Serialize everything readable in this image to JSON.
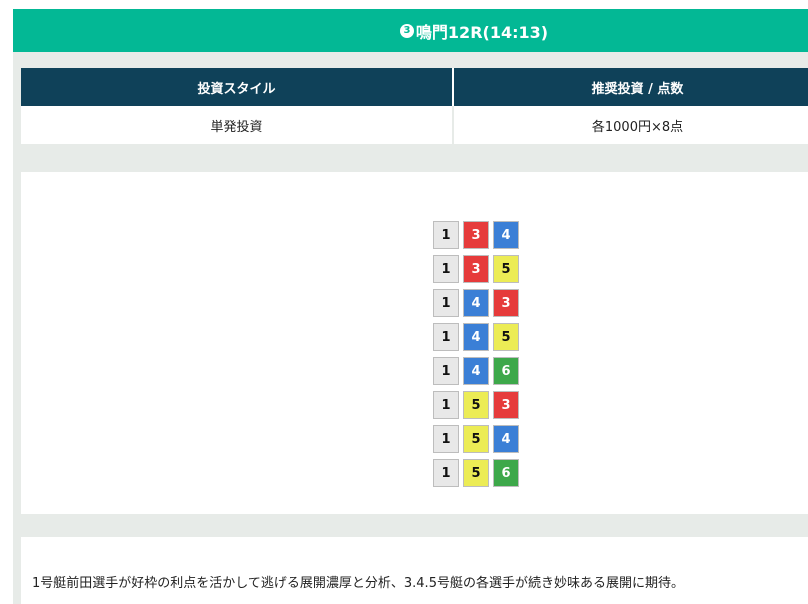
{
  "header": {
    "race_number": "3",
    "title": "鳴門12R(14:13)"
  },
  "bet_table": {
    "headers": [
      "投資スタイル",
      "推奨投資 / 点数"
    ],
    "row": [
      "単発投資",
      "各1000円×8点"
    ]
  },
  "boat_colors": {
    "1": {
      "bg": "#e8e8e8",
      "fg": "#111111"
    },
    "3": {
      "bg": "#e63b3b",
      "fg": "#ffffff"
    },
    "4": {
      "bg": "#3b7fd6",
      "fg": "#ffffff"
    },
    "5": {
      "bg": "#ecec55",
      "fg": "#111111"
    },
    "6": {
      "bg": "#3da84a",
      "fg": "#ffffff"
    }
  },
  "combinations": [
    [
      "1",
      "3",
      "4"
    ],
    [
      "1",
      "3",
      "5"
    ],
    [
      "1",
      "4",
      "3"
    ],
    [
      "1",
      "4",
      "5"
    ],
    [
      "1",
      "4",
      "6"
    ],
    [
      "1",
      "5",
      "3"
    ],
    [
      "1",
      "5",
      "4"
    ],
    [
      "1",
      "5",
      "6"
    ]
  ],
  "comment": "1号艇前田選手が好枠の利点を活かして逃げる展開濃厚と分析、3.4.5号艇の各選手が続き妙味ある展開に期待。"
}
